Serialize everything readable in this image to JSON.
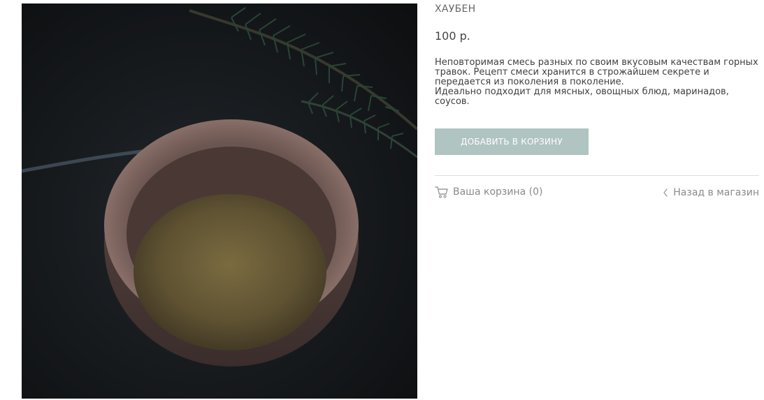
{
  "product": {
    "title": "ХАУБЕН",
    "price": "100 р.",
    "description": [
      "Неповторимая смесь разных по своим вкусовым качествам горных травок. Рецепт смеси хранится в строжайшем секрете и передается из поколения в поколение.",
      "Идеально подходит для мясных, овощных блюд, маринадов, соусов."
    ],
    "add_to_cart_label": "ДОБАВИТЬ В КОРЗИНУ"
  },
  "footer": {
    "cart_label": "Ваша корзина (0)",
    "back_label": "Назад в магазин"
  },
  "icons": {
    "cart": "cart-icon",
    "back": "chevron-left-icon"
  },
  "colors": {
    "button_bg": "#b0c4c1",
    "button_text": "#ffffff",
    "muted_text": "#8a8a8a",
    "divider": "#dddddd"
  }
}
